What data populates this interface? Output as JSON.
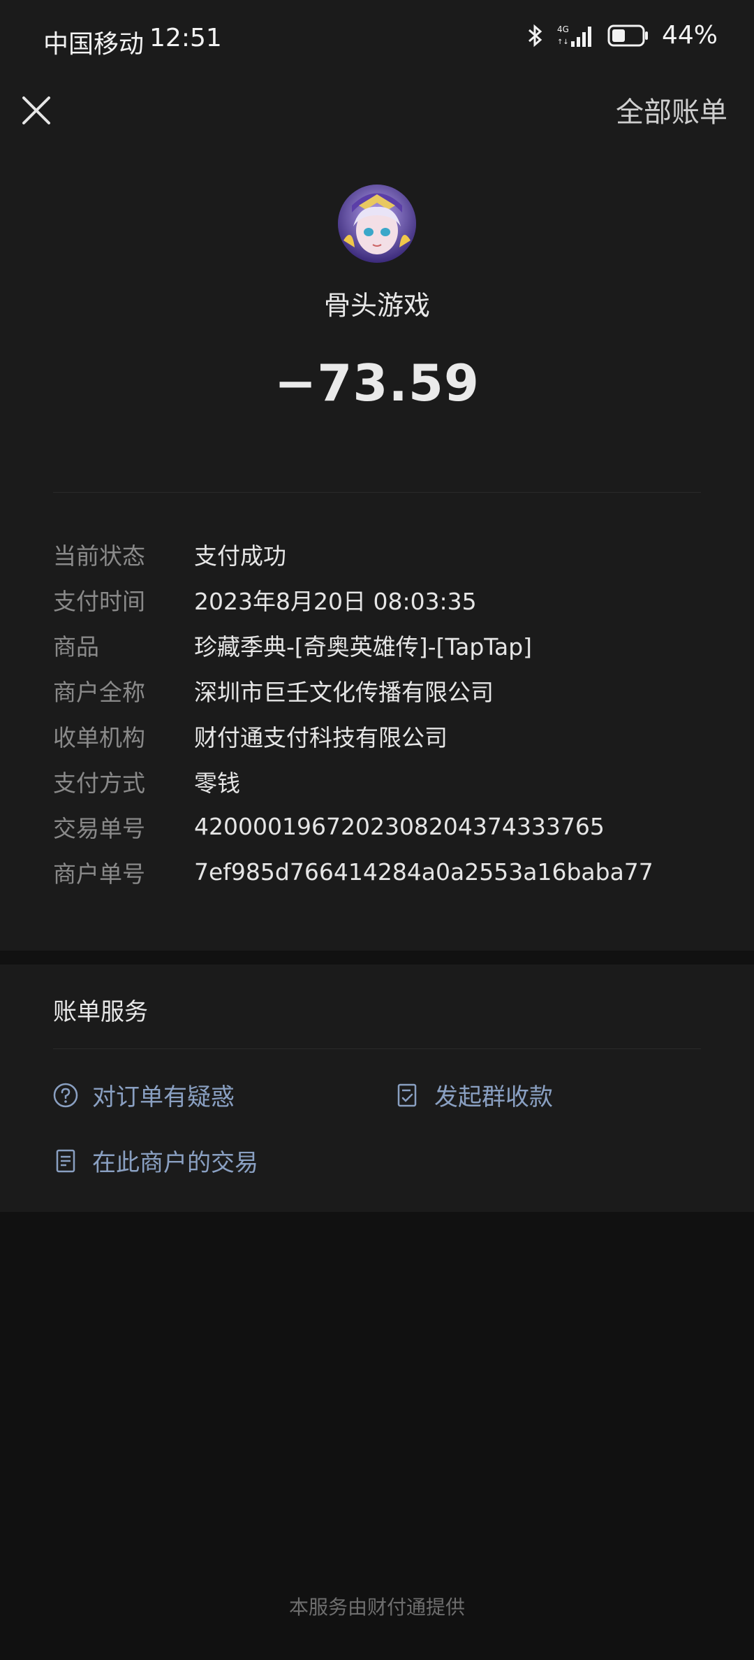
{
  "status_bar": {
    "carrier": "中国移动",
    "time": "12:51",
    "battery_percent": "44%",
    "battery_level": 0.44
  },
  "header": {
    "all_bills": "全部账单"
  },
  "merchant": {
    "name": "骨头游戏",
    "amount": "−73.59"
  },
  "details": [
    {
      "label": "当前状态",
      "value": "支付成功"
    },
    {
      "label": "支付时间",
      "value": "2023年8月20日 08:03:35"
    },
    {
      "label": "商品",
      "value": "珍藏季典-[奇奥英雄传]-[TapTap]"
    },
    {
      "label": "商户全称",
      "value": "深圳市巨壬文化传播有限公司"
    },
    {
      "label": "收单机构",
      "value": "财付通支付科技有限公司"
    },
    {
      "label": "支付方式",
      "value": "零钱"
    },
    {
      "label": "交易单号",
      "value": "4200001967202308204374333765"
    },
    {
      "label": "商户单号",
      "value": "7ef985d766414284a0a2553a16baba77"
    }
  ],
  "service": {
    "title": "账单服务",
    "items": [
      {
        "label": "对订单有疑惑",
        "icon": "question-circle-icon"
      },
      {
        "label": "发起群收款",
        "icon": "checklist-icon"
      },
      {
        "label": "在此商户的交易",
        "icon": "document-icon"
      }
    ]
  },
  "footer": "本服务由财付通提供"
}
